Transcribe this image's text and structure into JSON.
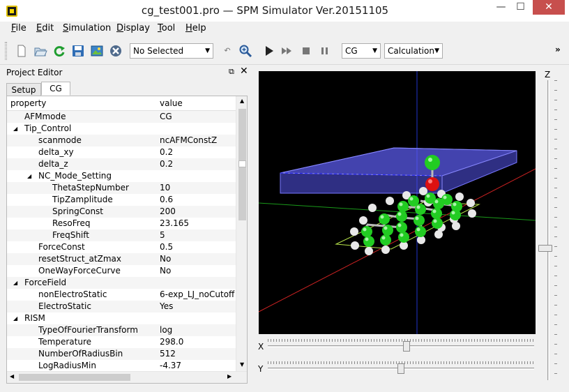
{
  "window": {
    "title": "cg_test001.pro — SPM Simulator Ver.20151105",
    "minimize_glyph": "—",
    "maximize_glyph": "☐",
    "close_glyph": "✕"
  },
  "menu": [
    {
      "label": "File",
      "underline": "F",
      "rest": "ile"
    },
    {
      "label": "Edit",
      "underline": "E",
      "rest": "dit"
    },
    {
      "label": "Simulation",
      "underline": "S",
      "rest": "imulation"
    },
    {
      "label": "Display",
      "underline": "D",
      "rest": "isplay"
    },
    {
      "label": "Tool",
      "underline": "T",
      "rest": "ool"
    },
    {
      "label": "Help",
      "underline": "H",
      "rest": "elp"
    }
  ],
  "toolbar": {
    "icons": [
      "new-file-icon",
      "open-folder-icon",
      "reload-icon",
      "save-icon",
      "export-image-icon",
      "cancel-icon"
    ],
    "selection_combo": "No Selected",
    "undo_icon": "undo-icon",
    "zoom_icon": "zoom-icon",
    "run_icons": [
      "play-icon",
      "fast-forward-icon",
      "stop-icon",
      "pause-icon"
    ],
    "mode_combo": "CG",
    "action_combo": "Calculation",
    "overflow": "»"
  },
  "project_editor": {
    "title": "Project Editor",
    "float_glyph": "⧉",
    "close_glyph": "✕",
    "tabs": [
      "Setup",
      "CG"
    ],
    "active_tab": "CG",
    "columns": [
      "property",
      "value"
    ],
    "rows": [
      {
        "key": "AFMmode",
        "value": "CG",
        "depth": 1,
        "expander": ""
      },
      {
        "key": "Tip_Control",
        "value": "",
        "depth": 1,
        "expander": "◢"
      },
      {
        "key": "scanmode",
        "value": "ncAFMConstZ",
        "depth": 2,
        "expander": ""
      },
      {
        "key": "delta_xy",
        "value": "0.2",
        "depth": 2,
        "expander": ""
      },
      {
        "key": "delta_z",
        "value": "0.2",
        "depth": 2,
        "expander": ""
      },
      {
        "key": "NC_Mode_Setting",
        "value": "",
        "depth": 2,
        "expander": "◢"
      },
      {
        "key": "ThetaStepNumber",
        "value": "10",
        "depth": 3,
        "expander": ""
      },
      {
        "key": "TipZamplitude",
        "value": "0.6",
        "depth": 3,
        "expander": ""
      },
      {
        "key": "SpringConst",
        "value": "200",
        "depth": 3,
        "expander": ""
      },
      {
        "key": "ResoFreq",
        "value": "23.165",
        "depth": 3,
        "expander": ""
      },
      {
        "key": "FreqShift",
        "value": "5",
        "depth": 3,
        "expander": ""
      },
      {
        "key": "ForceConst",
        "value": "0.5",
        "depth": 2,
        "expander": ""
      },
      {
        "key": "resetStruct_atZmax",
        "value": "No",
        "depth": 2,
        "expander": ""
      },
      {
        "key": "OneWayForceCurve",
        "value": "No",
        "depth": 2,
        "expander": ""
      },
      {
        "key": "ForceField",
        "value": "",
        "depth": 1,
        "expander": "◢"
      },
      {
        "key": "nonElectroStatic",
        "value": "6-exp_LJ_noCutoff",
        "depth": 2,
        "expander": ""
      },
      {
        "key": "ElectroStatic",
        "value": "Yes",
        "depth": 2,
        "expander": ""
      },
      {
        "key": "RISM",
        "value": "",
        "depth": 1,
        "expander": "◢"
      },
      {
        "key": "TypeOfFourierTransform",
        "value": "log",
        "depth": 2,
        "expander": ""
      },
      {
        "key": "Temperature",
        "value": "298.0",
        "depth": 2,
        "expander": ""
      },
      {
        "key": "NumberOfRadiusBin",
        "value": "512",
        "depth": 2,
        "expander": ""
      },
      {
        "key": "LogRadiusMin",
        "value": "-4.37",
        "depth": 2,
        "expander": ""
      }
    ],
    "scroll_glyphs": {
      "up": "▲",
      "down": "▼",
      "left": "◀",
      "right": "▶"
    }
  },
  "viewer": {
    "z_label": "Z",
    "x_label": "X",
    "y_label": "Y",
    "z_position": 0.56,
    "x_position": 0.52,
    "y_position": 0.5,
    "colors": {
      "background": "#000000",
      "x_axis": "#cc2222",
      "y_axis": "#22aa22",
      "z_axis": "#2233cc",
      "tip_box": "#5a5aff",
      "carbon": "#22cc22",
      "hydrogen": "#e8e8e8",
      "oxygen": "#dd1111"
    }
  }
}
